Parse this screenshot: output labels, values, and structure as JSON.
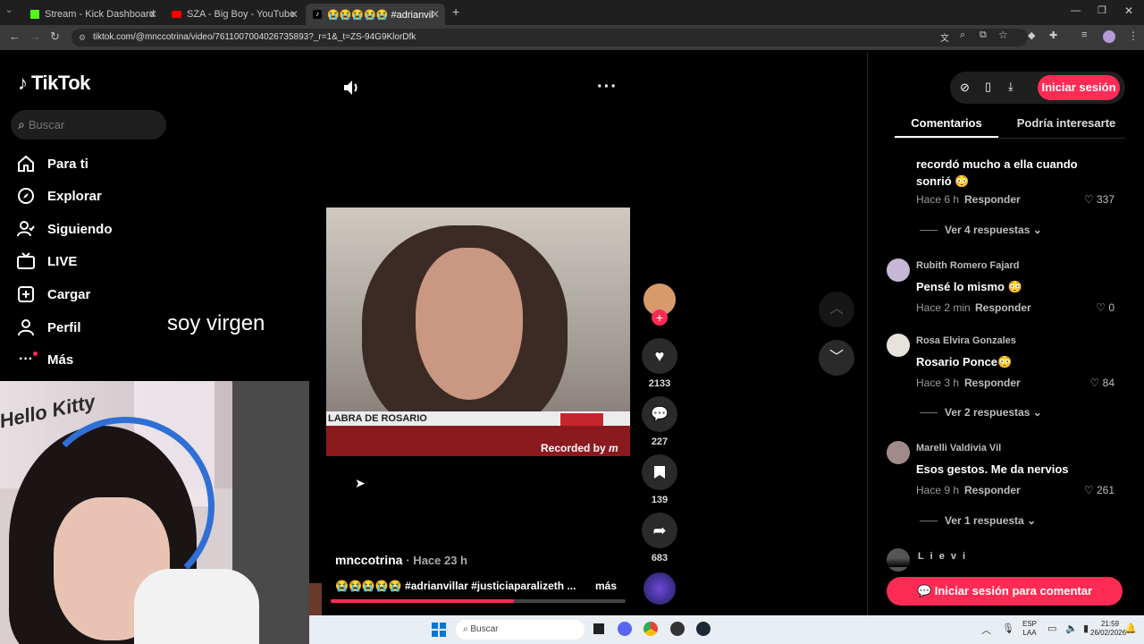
{
  "browser": {
    "tabs": [
      {
        "label": "Stream - Kick Dashboard"
      },
      {
        "label": "SZA - Big Boy - YouTube"
      },
      {
        "label": "😭😭😭😭😭 #adrianvillar #"
      }
    ],
    "url": "tiktok.com/@mnccotrina/video/7611007004026735893?_r=1&_t=ZS-94G9KlorDfk"
  },
  "tiktok": {
    "logo": "TikTok",
    "search_placeholder": "Buscar",
    "nav": [
      {
        "label": "Para ti"
      },
      {
        "label": "Explorar"
      },
      {
        "label": "Siguiendo"
      },
      {
        "label": "LIVE"
      },
      {
        "label": "Cargar"
      },
      {
        "label": "Perfil"
      },
      {
        "label": "Más"
      }
    ],
    "overlay_text": "soy virgen",
    "video": {
      "caption_banner": "LABRA DE ROSARIO",
      "watermark": "Recorded by",
      "author": "mnccotrina",
      "time": "· Hace 23 h",
      "description": "😭😭😭😭😭 #adrianvillar #justiciaparalizeth ...",
      "more": "más",
      "progress": 0.62
    },
    "actions": {
      "likes": "2133",
      "comments": "227",
      "saves": "139",
      "shares": "683"
    },
    "header": {
      "login_button": "Iniciar sesión"
    },
    "tabs": {
      "comments": "Comentarios",
      "suggested": "Podría interesarte"
    },
    "comments": [
      {
        "text": "recordó mucho a ella cuando sonrió 😳",
        "meta": "Hace 6 h",
        "reply": "Responder",
        "likes": "337",
        "replies": "Ver 4 respuestas"
      },
      {
        "user": "Rubith Romero Fajard",
        "text": "Pensé lo mismo 😳",
        "meta": "Hace 2 min",
        "reply": "Responder",
        "likes": "0"
      },
      {
        "user": "Rosa Elvira Gonzales",
        "text": "Rosario Ponce😳",
        "meta": "Hace 3 h",
        "reply": "Responder",
        "likes": "84",
        "replies": "Ver 2 respuestas"
      },
      {
        "user": "Marelli Valdivia Vil",
        "text": "Esos gestos. Me da nervios",
        "meta": "Hace 9 h",
        "reply": "Responder",
        "likes": "261",
        "replies": "Ver 1 respuesta"
      },
      {
        "user": "L i e v i"
      }
    ],
    "comment_login": "Iniciar sesión para comentar"
  },
  "taskbar": {
    "search": "Buscar",
    "lang": "ESP",
    "lang2": "LAA",
    "time": "21:59",
    "date": "26/02/2026"
  },
  "colors": {
    "brand": "#fe2c55",
    "bg": "#000000"
  }
}
